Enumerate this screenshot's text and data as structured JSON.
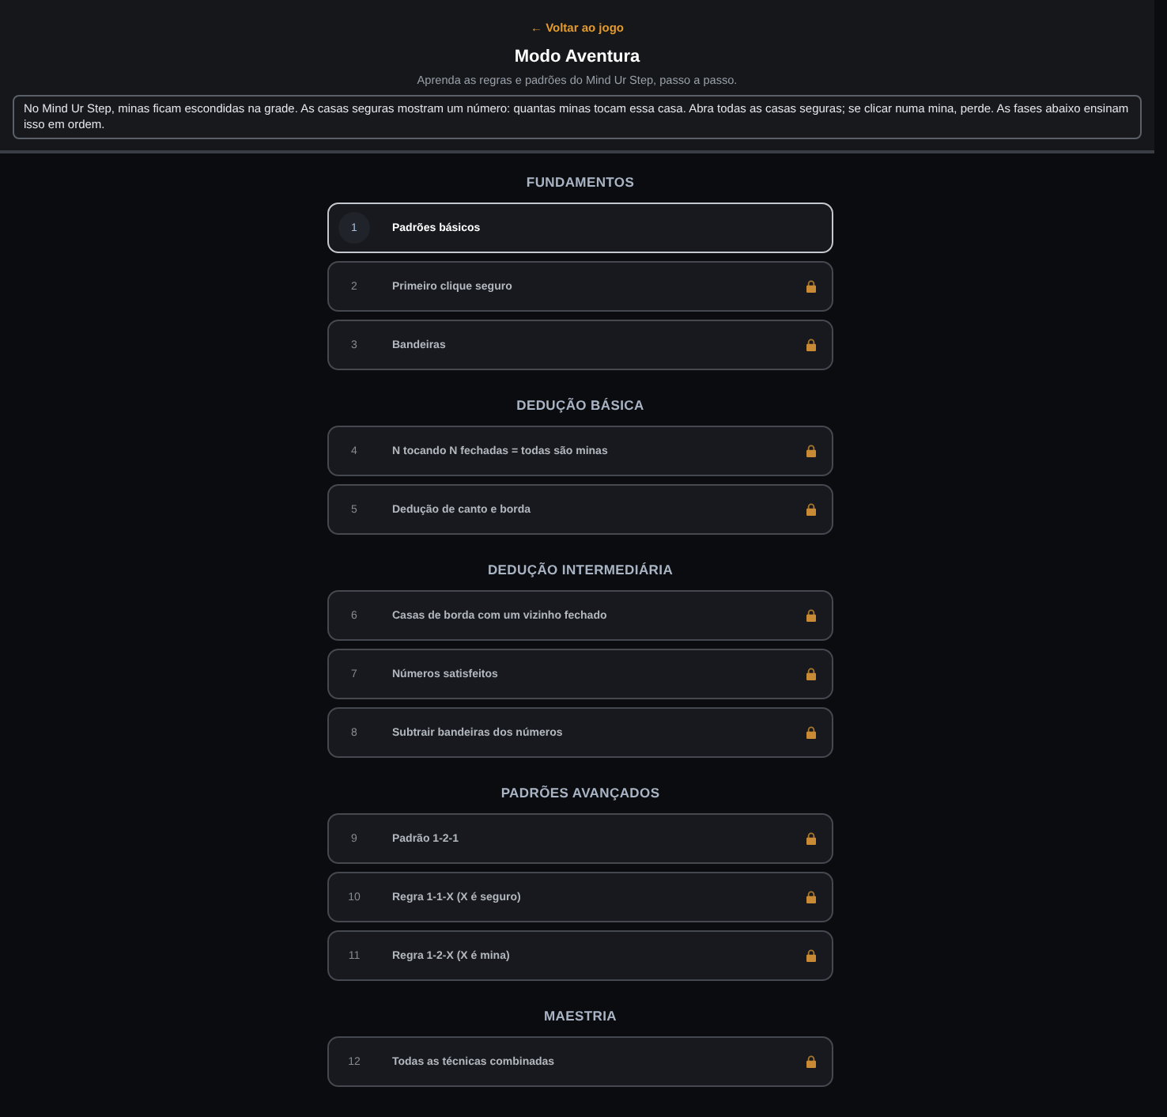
{
  "header": {
    "back_link": "← Voltar ao jogo",
    "title": "Modo Aventura",
    "subtitle": "Aprenda as regras e padrões do Mind Ur Step, passo a passo.",
    "intro": "No Mind Ur Step, minas ficam escondidas na grade. As casas seguras mostram um número: quantas minas tocam essa casa. Abra todas as casas seguras; se clicar numa mina, perde. As fases abaixo ensinam isso em ordem."
  },
  "sections": [
    {
      "heading": "FUNDAMENTOS",
      "lessons": [
        {
          "number": "1",
          "title": "Padrões básicos",
          "selected": true,
          "locked": false
        },
        {
          "number": "2",
          "title": "Primeiro clique seguro",
          "selected": false,
          "locked": true
        },
        {
          "number": "3",
          "title": "Bandeiras",
          "selected": false,
          "locked": true
        }
      ]
    },
    {
      "heading": "DEDUÇÃO BÁSICA",
      "lessons": [
        {
          "number": "4",
          "title": "N tocando N fechadas = todas são minas",
          "selected": false,
          "locked": true
        },
        {
          "number": "5",
          "title": "Dedução de canto e borda",
          "selected": false,
          "locked": true
        }
      ]
    },
    {
      "heading": "DEDUÇÃO INTERMEDIÁRIA",
      "lessons": [
        {
          "number": "6",
          "title": "Casas de borda com um vizinho fechado",
          "selected": false,
          "locked": true
        },
        {
          "number": "7",
          "title": "Números satisfeitos",
          "selected": false,
          "locked": true
        },
        {
          "number": "8",
          "title": "Subtrair bandeiras dos números",
          "selected": false,
          "locked": true
        }
      ]
    },
    {
      "heading": "PADRÕES AVANÇADOS",
      "lessons": [
        {
          "number": "9",
          "title": "Padrão 1-2-1",
          "selected": false,
          "locked": true
        },
        {
          "number": "10",
          "title": "Regra 1-1-X (X é seguro)",
          "selected": false,
          "locked": true
        },
        {
          "number": "11",
          "title": "Regra 1-2-X (X é mina)",
          "selected": false,
          "locked": true
        }
      ]
    },
    {
      "heading": "MAESTRIA",
      "lessons": [
        {
          "number": "12",
          "title": "Todas as técnicas combinadas",
          "selected": false,
          "locked": true
        }
      ]
    }
  ]
}
